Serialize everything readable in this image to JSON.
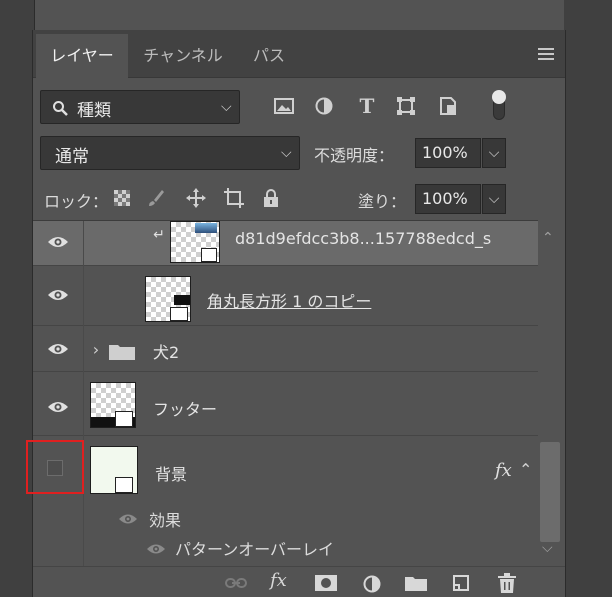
{
  "tabs": [
    {
      "label": "レイヤー",
      "active": true
    },
    {
      "label": "チャンネル",
      "active": false
    },
    {
      "label": "パス",
      "active": false
    }
  ],
  "filter": {
    "selected": "種類"
  },
  "blend_mode": {
    "selected": "通常"
  },
  "opacity": {
    "label": "不透明度：",
    "value": "100%"
  },
  "lock": {
    "label": "ロック："
  },
  "fill": {
    "label": "塗り：",
    "value": "100%"
  },
  "layers": [
    {
      "name": "d81d9efdcc3b8...157788edcd_s",
      "visible": true,
      "clipped": true,
      "selected": true
    },
    {
      "name": "角丸長方形 1 のコピー",
      "visible": true,
      "underline": true
    },
    {
      "name": "犬2",
      "visible": true,
      "type": "group",
      "collapsed": true
    },
    {
      "name": "フッター",
      "visible": true
    },
    {
      "name": "背景",
      "visible": false,
      "has_fx": true,
      "fx_label": "fx",
      "effects_label": "効果",
      "effects": [
        "パターンオーバーレイ"
      ]
    }
  ],
  "highlight_color": "#e02020",
  "accent_colors": {
    "panel": "#535353",
    "tabbar": "#424242",
    "field": "#383838"
  }
}
